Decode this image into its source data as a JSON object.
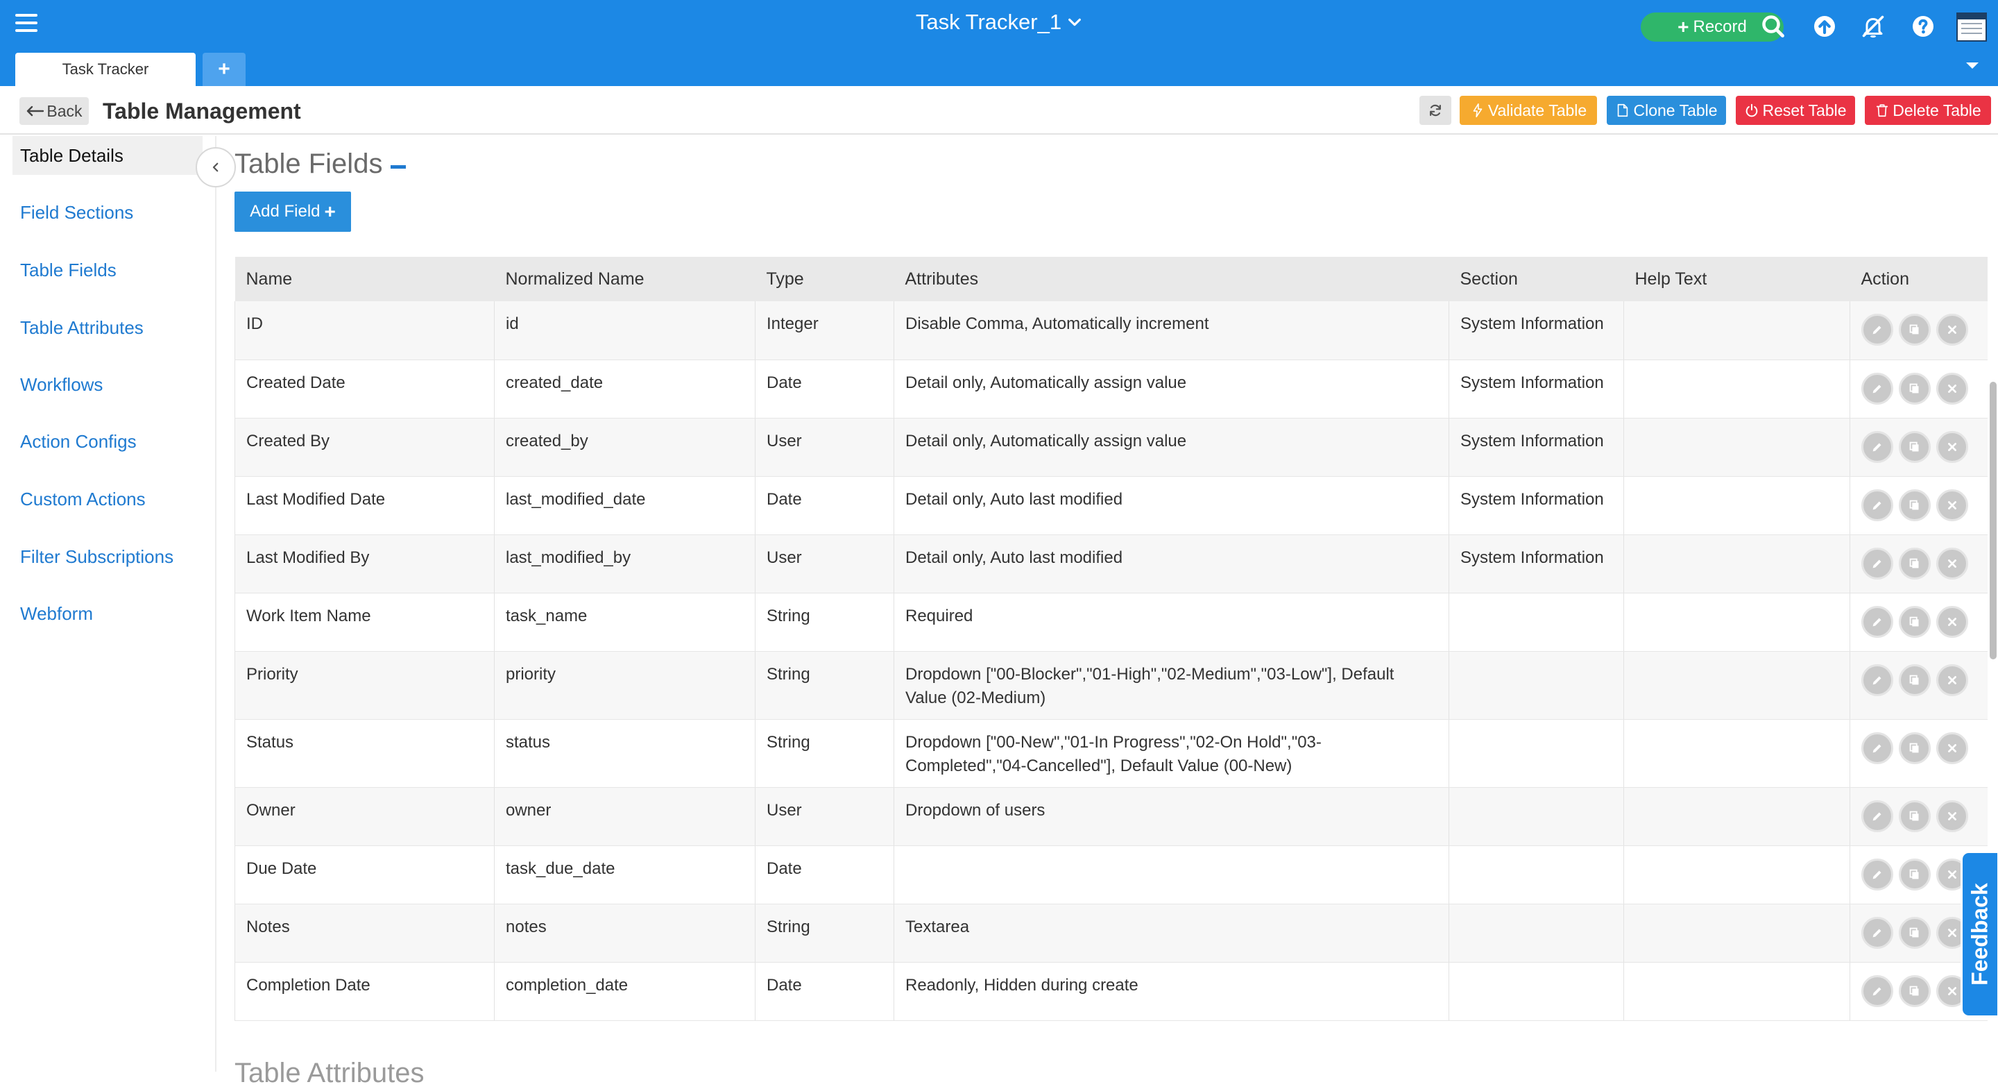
{
  "app": {
    "title": "Task Tracker_1",
    "record_label": "Record",
    "tabs": [
      {
        "label": "Task Tracker"
      }
    ],
    "add_tab_label": "+"
  },
  "header": {
    "back_label": "Back",
    "title": "Table Management",
    "buttons": {
      "validate": "Validate Table",
      "clone": "Clone Table",
      "reset": "Reset Table",
      "delete": "Delete Table"
    }
  },
  "sidebar": {
    "items": [
      {
        "label": "Table Details",
        "active": true
      },
      {
        "label": "Field Sections"
      },
      {
        "label": "Table Fields"
      },
      {
        "label": "Table Attributes"
      },
      {
        "label": "Workflows"
      },
      {
        "label": "Action Configs"
      },
      {
        "label": "Custom Actions"
      },
      {
        "label": "Filter Subscriptions"
      },
      {
        "label": "Webform"
      }
    ]
  },
  "main": {
    "section_title": "Table Fields",
    "add_field_label": "Add Field",
    "next_section_title": "Table Attributes",
    "columns": [
      "Name",
      "Normalized Name",
      "Type",
      "Attributes",
      "Section",
      "Help Text",
      "Action"
    ],
    "rows": [
      [
        "ID",
        "id",
        "Integer",
        "Disable Comma, Automatically increment",
        "System Information",
        ""
      ],
      [
        "Created Date",
        "created_date",
        "Date",
        "Detail only, Automatically assign value",
        "System Information",
        ""
      ],
      [
        "Created By",
        "created_by",
        "User",
        "Detail only, Automatically assign value",
        "System Information",
        ""
      ],
      [
        "Last Modified Date",
        "last_modified_date",
        "Date",
        "Detail only, Auto last modified",
        "System Information",
        ""
      ],
      [
        "Last Modified By",
        "last_modified_by",
        "User",
        "Detail only, Auto last modified",
        "System Information",
        ""
      ],
      [
        "Work Item Name",
        "task_name",
        "String",
        "Required",
        "",
        ""
      ],
      [
        "Priority",
        "priority",
        "String",
        "Dropdown [\"00-Blocker\",\"01-High\",\"02-Medium\",\"03-Low\"], Default Value (02-Medium)",
        "",
        ""
      ],
      [
        "Status",
        "status",
        "String",
        "Dropdown [\"00-New\",\"01-In Progress\",\"02-On Hold\",\"03-Completed\",\"04-Cancelled\"], Default Value (00-New)",
        "",
        ""
      ],
      [
        "Owner",
        "owner",
        "User",
        "Dropdown of users",
        "",
        ""
      ],
      [
        "Due Date",
        "task_due_date",
        "Date",
        "",
        "",
        ""
      ],
      [
        "Notes",
        "notes",
        "String",
        "Textarea",
        "",
        ""
      ],
      [
        "Completion Date",
        "completion_date",
        "Date",
        "Readonly, Hidden during create",
        "",
        ""
      ]
    ],
    "row_actions": [
      "edit-icon",
      "copy-icon",
      "delete-icon"
    ]
  },
  "feedback_label": "Feedback",
  "colors": {
    "topbar": "#1c88e5",
    "record": "#2fb66a",
    "validate": "#f6aa2f",
    "clone": "#2a8fdc",
    "danger": "#ea3344",
    "link": "#1f7ad0"
  }
}
